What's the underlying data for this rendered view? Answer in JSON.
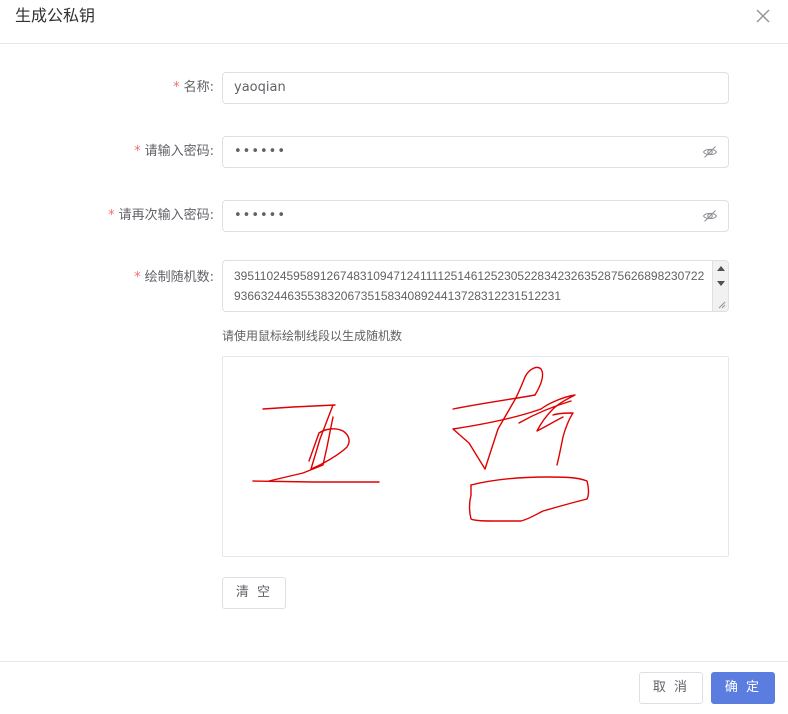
{
  "dialog": {
    "title": "生成公私钥",
    "close_icon": "close-icon"
  },
  "form": {
    "required_mark": "*",
    "name": {
      "label": "名称:",
      "value": "yaoqian"
    },
    "password": {
      "label": "请输入密码:",
      "value": "••••••",
      "icon": "eye-off-icon"
    },
    "confirm_password": {
      "label": "请再次输入密码:",
      "value": "••••••",
      "icon": "eye-off-icon"
    },
    "random": {
      "label": "绘制随机数:",
      "value": "395110245958912674831094712411112514612523052283423263528756268982307229366324463553832067351583408924413728312231512231"
    },
    "hint": "请使用鼠标绘制线段以生成随机数",
    "clear_label": "清 空"
  },
  "footer": {
    "cancel_label": "取 消",
    "confirm_label": "确 定"
  },
  "colors": {
    "accent": "#5b7de0",
    "required": "#f56c6c",
    "stroke": "#e00000"
  }
}
